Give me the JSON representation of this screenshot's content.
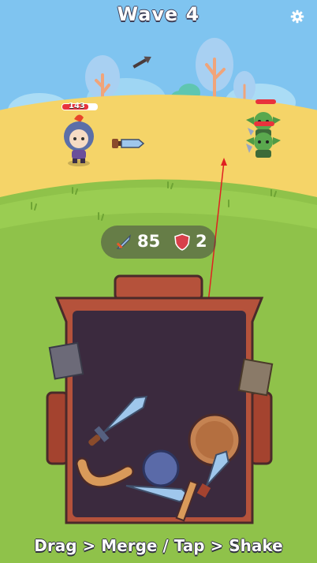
{
  "hud": {
    "wave_label": "Wave 4",
    "hint_text": "Drag > Merge / Tap > Shake"
  },
  "player": {
    "hp_value": "143",
    "hp_fraction": 0.75
  },
  "enemies": [
    {
      "name": "goblin-top",
      "hp_fraction": 1.0
    },
    {
      "name": "goblin-bottom",
      "hp_fraction": 1.0
    }
  ],
  "stats": {
    "attack_value": "85",
    "defense_value": "2"
  },
  "colors": {
    "sky": "#7fc4f0",
    "field": "#f5d468",
    "grass": "#8fc24a",
    "hp_red": "#e8323c",
    "chest_wood": "#b5523b",
    "chest_inside": "#3b2a3e",
    "aim_line": "#e02020"
  },
  "icons": [
    "gear-icon",
    "sword-stat-icon",
    "shield-stat-icon",
    "arrow-projectile-icon"
  ]
}
